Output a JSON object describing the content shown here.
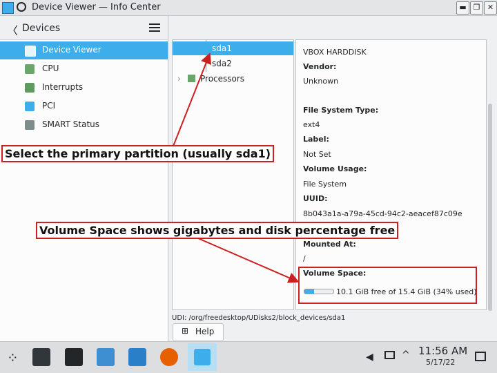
{
  "window": {
    "title": "Device Viewer — Info Center",
    "pin_icon": "pin-icon",
    "min_icon": "minimize-icon",
    "max_icon": "maximize-icon",
    "close_icon": "close-icon"
  },
  "sidebar": {
    "title": "Devices",
    "items": [
      {
        "label": "Device Viewer",
        "icon": "device-viewer-icon",
        "selected": true
      },
      {
        "label": "CPU",
        "icon": "cpu-icon"
      },
      {
        "label": "Interrupts",
        "icon": "interrupts-icon"
      },
      {
        "label": "PCI",
        "icon": "pci-icon"
      },
      {
        "label": "SMART Status",
        "icon": "smart-status-icon"
      }
    ]
  },
  "tree": {
    "rows": [
      {
        "label": "sda1",
        "selected": true
      },
      {
        "label": "sda2"
      },
      {
        "label": "Processors"
      }
    ]
  },
  "details": {
    "model_value": "VBOX HARDDISK",
    "vendor_label": "Vendor:",
    "vendor_value": "Unknown",
    "fstype_label": "File System Type:",
    "fstype_value": "ext4",
    "label_label": "Label:",
    "label_value": "Not Set",
    "usage_label": "Volume Usage:",
    "usage_value": "File System",
    "uuid_label": "UUID:",
    "uuid_value": "8b043a1a-a79a-45cd-94c2-aeacef87c09e",
    "mounted_label": "Mounted At:",
    "mounted_value": "/",
    "space_label": "Volume Space:",
    "space_value": "10.1 GiB free of 15.4 GiB (34% used)",
    "space_used_fraction": 0.34
  },
  "udi": "UDI: /org/freedesktop/UDisks2/block_devices/sda1",
  "help_label": "Help",
  "annotations": {
    "callout1": "Select the primary partition (usually sda1)",
    "callout2": "Volume Space shows gigabytes and disk percentage free"
  },
  "taskbar": {
    "time": "11:56 AM",
    "date": "5/17/22"
  }
}
